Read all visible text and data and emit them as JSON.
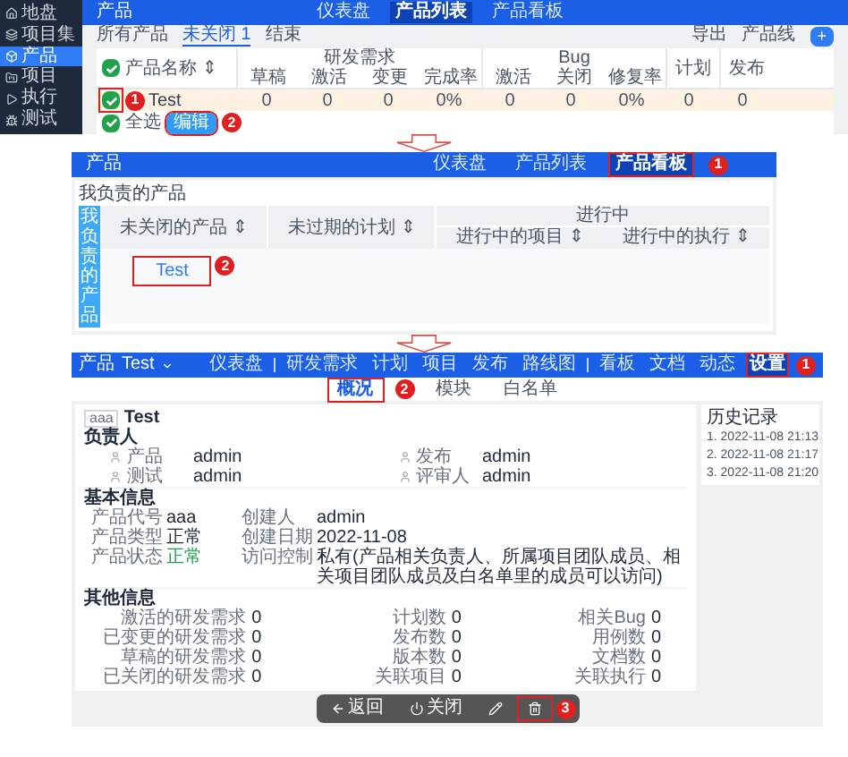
{
  "product_list": {
    "sidebar": [
      {
        "label": "地盘",
        "selected": false
      },
      {
        "label": "项目集",
        "selected": false
      },
      {
        "label": "产品",
        "selected": true
      },
      {
        "label": "项目",
        "selected": false
      },
      {
        "label": "执行",
        "selected": false
      },
      {
        "label": "测试",
        "selected": false
      }
    ],
    "header": {
      "title": "产品",
      "tabs": [
        {
          "label": "仪表盘",
          "selected": false
        },
        {
          "label": "产品列表",
          "selected": true
        },
        {
          "label": "产品看板",
          "selected": false
        }
      ]
    },
    "filters": [
      {
        "label": "所有产品",
        "selected": false
      },
      {
        "label": "未关闭",
        "count": "1",
        "selected": true
      },
      {
        "label": "结束",
        "selected": false
      }
    ],
    "actions": [
      {
        "label": "导出",
        "kind": "link"
      },
      {
        "label": "产品线",
        "kind": "link"
      },
      {
        "label": "+",
        "kind": "primary"
      }
    ],
    "table": {
      "all_checked": true,
      "name_column": "产品名称 ⇕",
      "groups": [
        {
          "label": "研发需求",
          "columns": [
            "草稿",
            "激活",
            "变更",
            "完成率"
          ]
        },
        {
          "label": "Bug",
          "columns": [
            "激活",
            "关闭",
            "修复率"
          ]
        }
      ],
      "extra_columns": [
        "计划",
        "发布"
      ],
      "rows": [
        {
          "name": "Test",
          "checked": true,
          "highlighted": true,
          "marker": "1",
          "values": [
            "0",
            "0",
            "0",
            "0%",
            "0",
            "0",
            "0%",
            "0",
            "0"
          ]
        }
      ]
    },
    "footer": {
      "select_all": "全选",
      "checked": true,
      "button": "编辑",
      "highlighted": true,
      "marker": "2"
    }
  },
  "product_kanban": {
    "header": {
      "title": "产品",
      "tabs": [
        {
          "label": "仪表盘",
          "selected": false,
          "highlighted": false
        },
        {
          "label": "产品列表",
          "selected": false,
          "highlighted": false
        },
        {
          "label": "产品看板",
          "selected": true,
          "highlighted": true,
          "marker": "1"
        }
      ]
    },
    "section_title": "我负责的产品",
    "side_label": "我负责的产品",
    "columns": [
      "未关闭的产品 ⇕",
      "未过期的计划 ⇕"
    ],
    "group": {
      "label": "进行中",
      "columns": [
        "进行中的项目 ⇕",
        "进行中的执行 ⇕"
      ]
    },
    "rows": [
      {
        "product": "Test",
        "highlighted": true,
        "marker": "2"
      }
    ]
  },
  "product_overview": {
    "breadcrumb": [
      "产品",
      "Test"
    ],
    "nav": [
      {
        "label": "仪表盘",
        "selected": false,
        "highlighted": false,
        "separator_after": true
      },
      {
        "label": "研发需求",
        "selected": false,
        "highlighted": false,
        "separator_after": false
      },
      {
        "label": "计划",
        "selected": false,
        "highlighted": false,
        "separator_after": false
      },
      {
        "label": "项目",
        "selected": false,
        "highlighted": false,
        "separator_after": false
      },
      {
        "label": "发布",
        "selected": false,
        "highlighted": false,
        "separator_after": false
      },
      {
        "label": "路线图",
        "selected": false,
        "highlighted": false,
        "separator_after": true
      },
      {
        "label": "看板",
        "selected": false,
        "highlighted": false,
        "separator_after": false
      },
      {
        "label": "文档",
        "selected": false,
        "highlighted": false,
        "separator_after": false
      },
      {
        "label": "动态",
        "selected": false,
        "highlighted": false,
        "separator_after": false
      },
      {
        "label": "设置",
        "selected": true,
        "highlighted": true,
        "separator_after": false,
        "marker": "1"
      }
    ],
    "subtabs": [
      {
        "label": "概况",
        "selected": true,
        "highlighted": true,
        "marker": "2"
      },
      {
        "label": "模块",
        "selected": false,
        "highlighted": false
      },
      {
        "label": "白名单",
        "selected": false,
        "highlighted": false
      }
    ],
    "product": {
      "code": "aaa",
      "name": "Test"
    },
    "owners": {
      "title": "负责人",
      "items": [
        {
          "role": "产品",
          "name": "admin"
        },
        {
          "role": "发布",
          "name": "admin"
        },
        {
          "role": "测试",
          "name": "admin"
        },
        {
          "role": "评审人",
          "name": "admin"
        }
      ]
    },
    "basic": {
      "title": "基本信息",
      "items": [
        {
          "label": "产品代号",
          "value": "aaa",
          "kind": "text"
        },
        {
          "label": "创建人",
          "value": "admin",
          "kind": "text"
        },
        {
          "label": "产品类型",
          "value": "正常",
          "kind": "text"
        },
        {
          "label": "创建日期",
          "value": "2022-11-08",
          "kind": "text"
        },
        {
          "label": "产品状态",
          "value": "正常",
          "kind": "status"
        },
        {
          "label": "访问控制",
          "value": "私有(产品相关负责人、所属项目团队成员、相关项目团队成员及白名单里的成员可以访问)",
          "kind": "text"
        }
      ]
    },
    "other": {
      "title": "其他信息",
      "items": [
        {
          "label": "激活的研发需求",
          "value": "0"
        },
        {
          "label": "计划数",
          "value": "0"
        },
        {
          "label": "相关Bug",
          "value": "0"
        },
        {
          "label": "已变更的研发需求",
          "value": "0"
        },
        {
          "label": "发布数",
          "value": "0"
        },
        {
          "label": "用例数",
          "value": "0"
        },
        {
          "label": "草稿的研发需求",
          "value": "0"
        },
        {
          "label": "版本数",
          "value": "0"
        },
        {
          "label": "文档数",
          "value": "0"
        },
        {
          "label": "已关闭的研发需求",
          "value": "0"
        },
        {
          "label": "关联项目",
          "value": "0"
        },
        {
          "label": "关联执行",
          "value": "0"
        }
      ]
    },
    "history": {
      "title": "历史记录",
      "entries": [
        "1. 2022-11-08 21:13",
        "2. 2022-11-08 21:17",
        "3. 2022-11-08 21:20"
      ]
    },
    "toolbar": [
      {
        "kind": "back",
        "label": "返回",
        "highlighted": false
      },
      {
        "kind": "close",
        "label": "关闭",
        "highlighted": false
      },
      {
        "kind": "edit",
        "highlighted": false
      },
      {
        "kind": "delete",
        "highlighted": true,
        "marker": "3"
      }
    ]
  }
}
